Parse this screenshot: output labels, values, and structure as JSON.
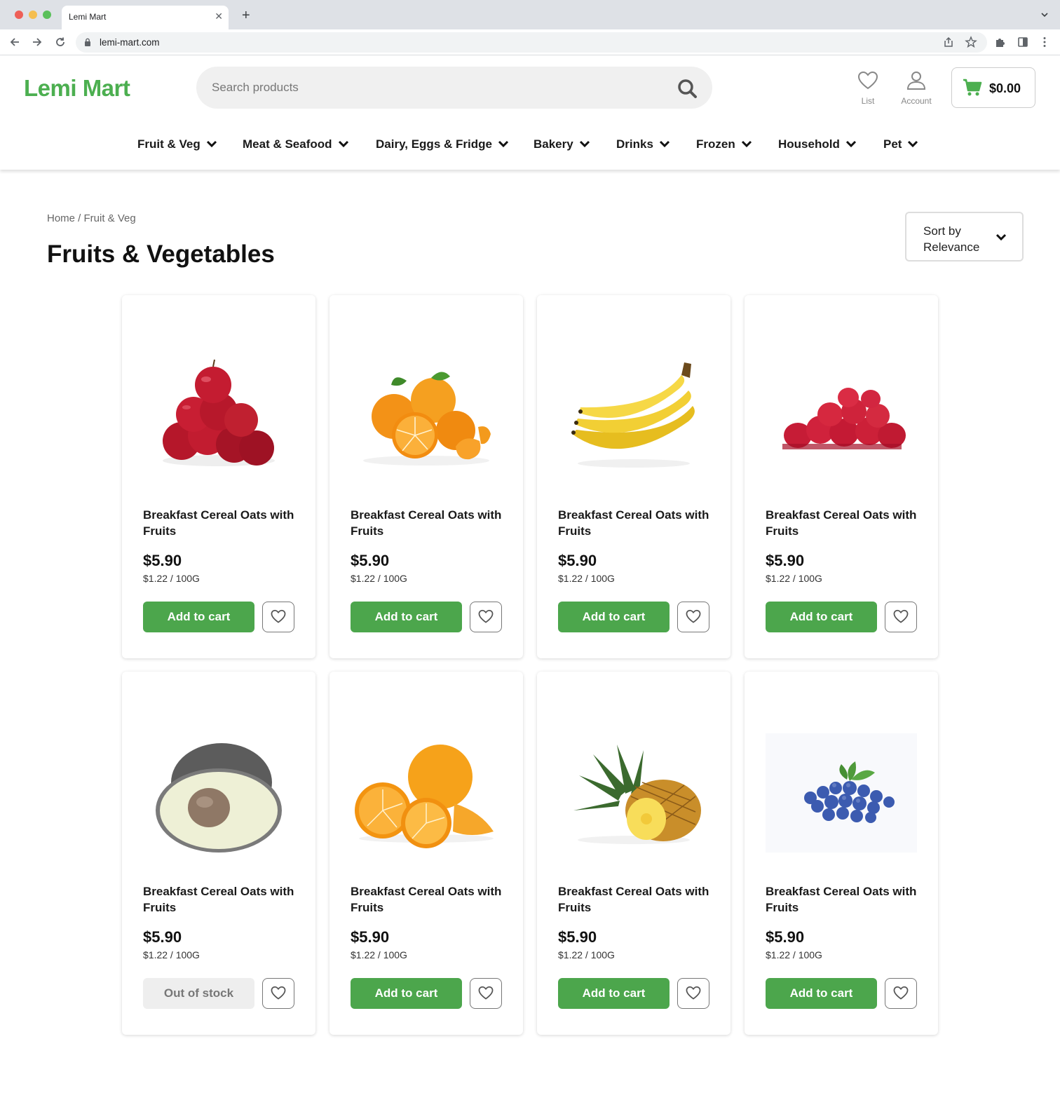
{
  "browser": {
    "tab_title": "Lemi Mart",
    "url": "lemi-mart.com"
  },
  "header": {
    "logo": "Lemi Mart",
    "search_placeholder": "Search products",
    "list_label": "List",
    "account_label": "Account",
    "cart_total": "$0.00",
    "brand_color": "#4caf50"
  },
  "categories": [
    "Fruit & Veg",
    "Meat & Seafood",
    "Dairy, Eggs & Fridge",
    "Bakery",
    "Drinks",
    "Frozen",
    "Household",
    "Pet"
  ],
  "page": {
    "breadcrumb": "Home / Fruit & Veg",
    "title": "Fruits & Vegetables",
    "sort_label_line1": "Sort by",
    "sort_label_line2": "Relevance"
  },
  "products": [
    {
      "name": "Breakfast Cereal Oats with Fruits",
      "price": "$5.90",
      "unit_price": "$1.22 / 100G",
      "button": "Add to cart",
      "image": "apples-image",
      "in_stock": true
    },
    {
      "name": "Breakfast Cereal Oats with Fruits",
      "price": "$5.90",
      "unit_price": "$1.22 / 100G",
      "button": "Add to cart",
      "image": "mandarins-image",
      "in_stock": true
    },
    {
      "name": "Breakfast Cereal Oats with Fruits",
      "price": "$5.90",
      "unit_price": "$1.22 / 100G",
      "button": "Add to cart",
      "image": "bananas-image",
      "in_stock": true
    },
    {
      "name": "Breakfast Cereal Oats with Fruits",
      "price": "$5.90",
      "unit_price": "$1.22 / 100G",
      "button": "Add to cart",
      "image": "raspberries-image",
      "in_stock": true
    },
    {
      "name": "Breakfast Cereal Oats with Fruits",
      "price": "$5.90",
      "unit_price": "$1.22 / 100G",
      "button": "Out of stock",
      "image": "avocado-image",
      "in_stock": false
    },
    {
      "name": "Breakfast Cereal Oats with Fruits",
      "price": "$5.90",
      "unit_price": "$1.22 / 100G",
      "button": "Add to cart",
      "image": "oranges-image",
      "in_stock": true
    },
    {
      "name": "Breakfast Cereal Oats with Fruits",
      "price": "$5.90",
      "unit_price": "$1.22 / 100G",
      "button": "Add to cart",
      "image": "pineapple-image",
      "in_stock": true
    },
    {
      "name": "Breakfast Cereal Oats with Fruits",
      "price": "$5.90",
      "unit_price": "$1.22 / 100G",
      "button": "Add to cart",
      "image": "blueberries-image",
      "in_stock": true
    }
  ]
}
